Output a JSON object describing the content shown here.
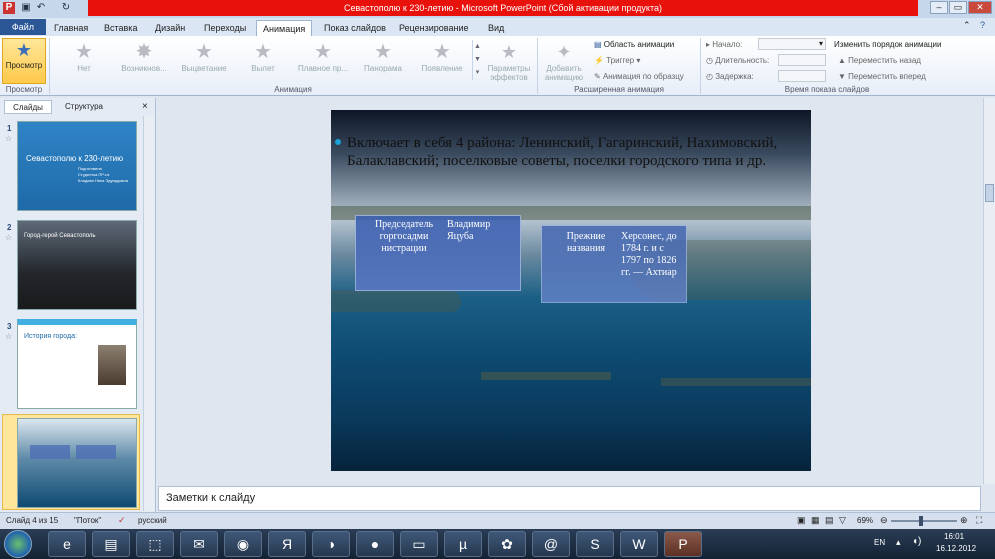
{
  "window": {
    "title": "Севастополю к 230-летию  -  Microsoft PowerPoint (Сбой активации продукта)"
  },
  "tabs": [
    "Главная",
    "Вставка",
    "Дизайн",
    "Переходы",
    "Анимация",
    "Показ слайдов",
    "Рецензирование",
    "Вид"
  ],
  "file_tab": "Файл",
  "ribbon": {
    "preview": "Просмотр",
    "effects": [
      "Нет",
      "Возникнов...",
      "Выцветание",
      "Вылет",
      "Плавное пр...",
      "Панорама",
      "Появление"
    ],
    "effect_params": "Параметры эффектов",
    "add_animation": "Добавить анимацию",
    "animation_pane": "Область анимации",
    "trigger": "Триггер",
    "anim_painter": "Анимация по образцу",
    "start_label": "Начало:",
    "duration_label": "Длительность:",
    "delay_label": "Задержка:",
    "reorder_title": "Изменить порядок анимации",
    "move_earlier": "Переместить назад",
    "move_later": "Переместить вперед",
    "groups": {
      "preview": "Просмотр",
      "animation": "Анимация",
      "advanced": "Расширенная анимация",
      "timing": "Время показа слайдов"
    }
  },
  "panel": {
    "tab_slides": "Слайды",
    "tab_outline": "Структура",
    "close": "×"
  },
  "thumbnails": [
    {
      "num": "1",
      "title": "Севастополю к 230-летию",
      "sub": "Подготовила\nСтудентка ПР-нз\nКлодова Нина Эдуардовна"
    },
    {
      "num": "2",
      "title": "Город-герой Севастополь"
    },
    {
      "num": "3",
      "title": "История города:"
    },
    {
      "num": "4",
      "title": ""
    }
  ],
  "slide": {
    "bullet": "Включает в себя 4 района: Ленинский, Гагаринский, Нахимовский, Балаклавский; поселковые советы, поселки городского типа и др.",
    "box1_left": "Председатель горгосадми нистрации",
    "box1_right": "Владимир Яцуба",
    "box2_left": "Прежние названия",
    "box2_right": "Херсонес, до 1784 г. и с 1797 по 1826 гг. — Ахтиар"
  },
  "notes_placeholder": "Заметки к слайду",
  "status": {
    "slide": "Слайд 4 из 15",
    "theme": "\"Поток\"",
    "lang": "русский",
    "zoom": "69%"
  },
  "taskbar": {
    "lang": "EN",
    "time": "16:01",
    "date": "16.12.2012"
  },
  "colors": {
    "file_tab": "#2b5797",
    "title_bar": "#e8110c",
    "bullet": "#1ca0d8"
  }
}
